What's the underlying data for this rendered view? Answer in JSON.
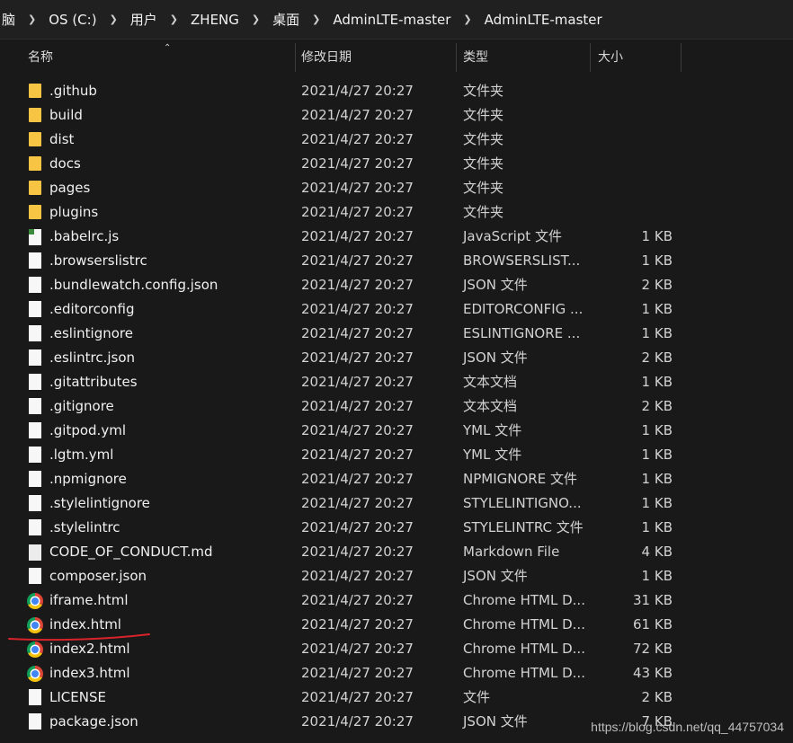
{
  "breadcrumb": [
    "脑",
    "OS (C:)",
    "用户",
    "ZHENG",
    "桌面",
    "AdminLTE-master",
    "AdminLTE-master"
  ],
  "columns": {
    "name": "名称",
    "modified": "修改日期",
    "type": "类型",
    "size": "大小"
  },
  "files": [
    {
      "name": ".github",
      "modified": "2021/4/27 20:27",
      "type": "文件夹",
      "size": "",
      "icon": "folder-icon"
    },
    {
      "name": "build",
      "modified": "2021/4/27 20:27",
      "type": "文件夹",
      "size": "",
      "icon": "folder-icon"
    },
    {
      "name": "dist",
      "modified": "2021/4/27 20:27",
      "type": "文件夹",
      "size": "",
      "icon": "folder-icon"
    },
    {
      "name": "docs",
      "modified": "2021/4/27 20:27",
      "type": "文件夹",
      "size": "",
      "icon": "folder-icon"
    },
    {
      "name": "pages",
      "modified": "2021/4/27 20:27",
      "type": "文件夹",
      "size": "",
      "icon": "folder-icon"
    },
    {
      "name": "plugins",
      "modified": "2021/4/27 20:27",
      "type": "文件夹",
      "size": "",
      "icon": "folder-icon"
    },
    {
      "name": ".babelrc.js",
      "modified": "2021/4/27 20:27",
      "type": "JavaScript 文件",
      "size": "1 KB",
      "icon": "js-file-icon"
    },
    {
      "name": ".browserslistrc",
      "modified": "2021/4/27 20:27",
      "type": "BROWSERSLIST...",
      "size": "1 KB",
      "icon": "file-icon"
    },
    {
      "name": ".bundlewatch.config.json",
      "modified": "2021/4/27 20:27",
      "type": "JSON 文件",
      "size": "2 KB",
      "icon": "file-icon"
    },
    {
      "name": ".editorconfig",
      "modified": "2021/4/27 20:27",
      "type": "EDITORCONFIG ...",
      "size": "1 KB",
      "icon": "file-icon"
    },
    {
      "name": ".eslintignore",
      "modified": "2021/4/27 20:27",
      "type": "ESLINTIGNORE ...",
      "size": "1 KB",
      "icon": "file-icon"
    },
    {
      "name": ".eslintrc.json",
      "modified": "2021/4/27 20:27",
      "type": "JSON 文件",
      "size": "2 KB",
      "icon": "file-icon"
    },
    {
      "name": ".gitattributes",
      "modified": "2021/4/27 20:27",
      "type": "文本文档",
      "size": "1 KB",
      "icon": "text-file-icon"
    },
    {
      "name": ".gitignore",
      "modified": "2021/4/27 20:27",
      "type": "文本文档",
      "size": "2 KB",
      "icon": "text-file-icon"
    },
    {
      "name": ".gitpod.yml",
      "modified": "2021/4/27 20:27",
      "type": "YML 文件",
      "size": "1 KB",
      "icon": "file-icon"
    },
    {
      "name": ".lgtm.yml",
      "modified": "2021/4/27 20:27",
      "type": "YML 文件",
      "size": "1 KB",
      "icon": "file-icon"
    },
    {
      "name": ".npmignore",
      "modified": "2021/4/27 20:27",
      "type": "NPMIGNORE 文件",
      "size": "1 KB",
      "icon": "file-icon"
    },
    {
      "name": ".stylelintignore",
      "modified": "2021/4/27 20:27",
      "type": "STYLELINTIGNO...",
      "size": "1 KB",
      "icon": "file-icon"
    },
    {
      "name": ".stylelintrc",
      "modified": "2021/4/27 20:27",
      "type": "STYLELINTRC 文件",
      "size": "1 KB",
      "icon": "file-icon"
    },
    {
      "name": "CODE_OF_CONDUCT.md",
      "modified": "2021/4/27 20:27",
      "type": "Markdown File",
      "size": "4 KB",
      "icon": "markdown-file-icon"
    },
    {
      "name": "composer.json",
      "modified": "2021/4/27 20:27",
      "type": "JSON 文件",
      "size": "1 KB",
      "icon": "file-icon"
    },
    {
      "name": "iframe.html",
      "modified": "2021/4/27 20:27",
      "type": "Chrome HTML D...",
      "size": "31 KB",
      "icon": "chrome-icon"
    },
    {
      "name": "index.html",
      "modified": "2021/4/27 20:27",
      "type": "Chrome HTML D...",
      "size": "61 KB",
      "icon": "chrome-icon"
    },
    {
      "name": "index2.html",
      "modified": "2021/4/27 20:27",
      "type": "Chrome HTML D...",
      "size": "72 KB",
      "icon": "chrome-icon"
    },
    {
      "name": "index3.html",
      "modified": "2021/4/27 20:27",
      "type": "Chrome HTML D...",
      "size": "43 KB",
      "icon": "chrome-icon"
    },
    {
      "name": "LICENSE",
      "modified": "2021/4/27 20:27",
      "type": "文件",
      "size": "2 KB",
      "icon": "file-icon"
    },
    {
      "name": "package.json",
      "modified": "2021/4/27 20:27",
      "type": "JSON 文件",
      "size": "7 KB",
      "icon": "file-icon"
    }
  ],
  "watermark": "https://blog.csdn.net/qq_44757034",
  "colors": {
    "background": "#191919",
    "folder": "#f8c443",
    "annotation": "#d8232a"
  }
}
